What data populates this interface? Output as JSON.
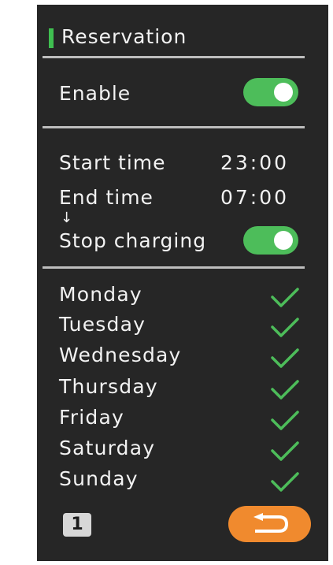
{
  "header": {
    "title": "Reservation"
  },
  "enable": {
    "label": "Enable",
    "on": true
  },
  "schedule": {
    "start_label": "Start time",
    "start_value": "23:00",
    "end_label": "End time",
    "end_value": "07:00",
    "arrow": "↓",
    "stop_label": "Stop charging",
    "stop_on": true
  },
  "days": [
    {
      "label": "Monday",
      "checked": true
    },
    {
      "label": "Tuesday",
      "checked": true
    },
    {
      "label": "Wednesday",
      "checked": true
    },
    {
      "label": "Thursday",
      "checked": true
    },
    {
      "label": "Friday",
      "checked": true
    },
    {
      "label": "Saturday",
      "checked": true
    },
    {
      "label": "Sunday",
      "checked": true
    }
  ],
  "footer": {
    "page_number": "1",
    "back_icon": "return-arrow-icon"
  },
  "colors": {
    "background": "#262626",
    "accent_green": "#4dbd5a",
    "back_orange": "#f08a2e",
    "divider": "#bdbdbd"
  }
}
